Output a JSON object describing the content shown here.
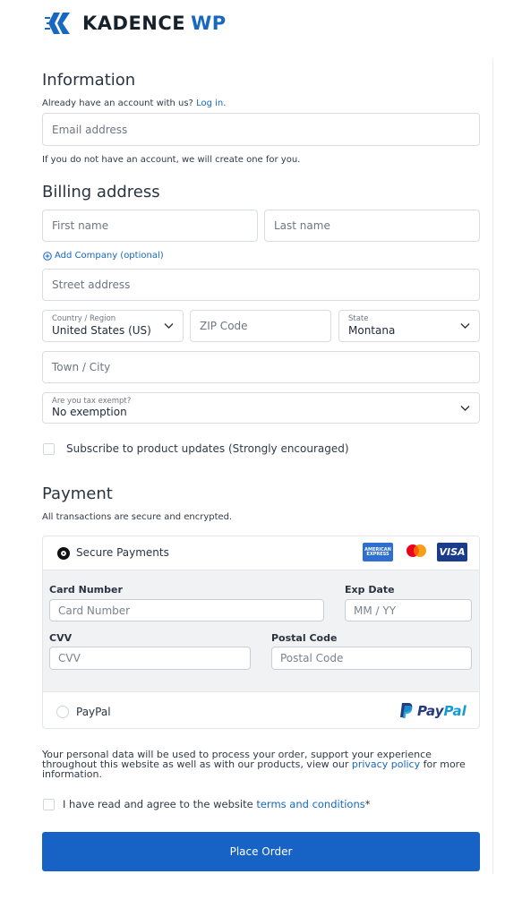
{
  "brand": {
    "name": "KADENCE",
    "suffix": "WP"
  },
  "information": {
    "heading": "Information",
    "account_prompt": "Already have an account with us?",
    "login_link": "Log in.",
    "email_placeholder": "Email address",
    "no_account_note": "If you do not have an account, we will create one for you."
  },
  "billing": {
    "heading": "Billing address",
    "first_name_placeholder": "First name",
    "last_name_placeholder": "Last name",
    "add_company": "Add Company (optional)",
    "street_placeholder": "Street address",
    "country_label": "Country / Region",
    "country_value": "United States (US)",
    "zip_placeholder": "ZIP Code",
    "state_label": "State",
    "state_value": "Montana",
    "city_placeholder": "Town / City",
    "tax_label": "Are you tax exempt?",
    "tax_value": "No exemption",
    "subscribe_label": "Subscribe to product updates (Strongly encouraged)"
  },
  "payment": {
    "heading": "Payment",
    "secure_note": "All transactions are secure and encrypted.",
    "secure_payments_label": "Secure Payments",
    "card_icons": [
      "amex-icon",
      "mastercard-icon",
      "visa-icon"
    ],
    "amex_text": "AMERICAN EXPRESS",
    "visa_text": "VISA",
    "card_number_label": "Card Number",
    "card_number_placeholder": "Card Number",
    "exp_label": "Exp Date",
    "exp_placeholder": "MM / YY",
    "cvv_label": "CVV",
    "cvv_placeholder": "CVV",
    "postal_label": "Postal Code",
    "postal_placeholder": "Postal Code",
    "paypal_label": "PayPal",
    "paypal_logo_pay": "Pay",
    "paypal_logo_pal": "Pal"
  },
  "privacy": {
    "text_before": "Your personal data will be used to process your order, support your experience throughout this website as well as with our products, view our",
    "privacy_link": "privacy policy",
    "text_after": "for more information."
  },
  "terms": {
    "text": "I have read and agree to the website",
    "link": "terms and conditions",
    "required": "*"
  },
  "place_order": "Place Order",
  "colors": {
    "accent": "#1668c1",
    "button": "#1763c5"
  }
}
